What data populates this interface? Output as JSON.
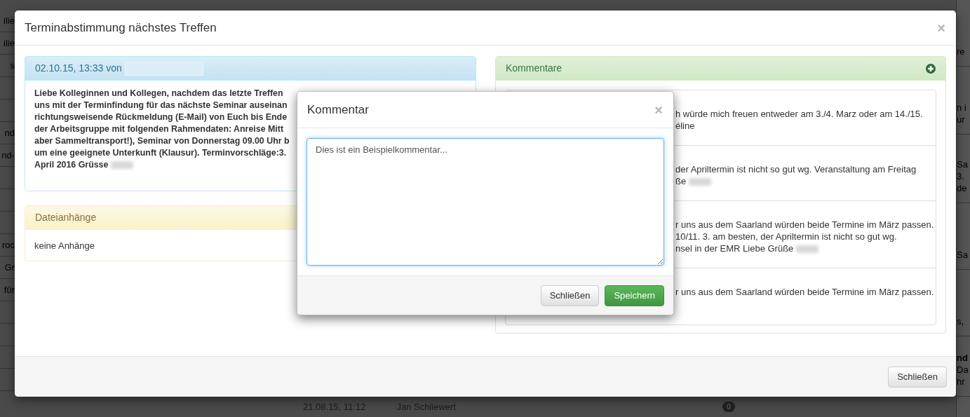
{
  "dialog": {
    "title": "Terminabstimmung nächstes Treffen",
    "close": "×",
    "message": {
      "meta": "02.10.15, 13:33 von",
      "meta_redacted": true,
      "body_lines": [
        {
          "text": "Liebe Kolleginnen und Kollegen, nachdem das letzte Treffen",
          "redacted_after": false
        },
        {
          "text": "uns mit der Terminfindung für das nächste Seminar auseinan",
          "redacted_after": false
        },
        {
          "text": "richtungsweisende Rückmeldung (E-Mail) von Euch bis Ende",
          "redacted_after": false
        },
        {
          "text": "der Arbeitsgruppe mit folgenden Rahmendaten: Anreise Mitt",
          "redacted_after": false
        },
        {
          "text": "aber Sammeltransport!), Seminar von Donnerstag 09.00 Uhr b",
          "redacted_after": false
        },
        {
          "text": "um eine geeignete Unterkunft (Klausur). Terminvorschläge:3.",
          "redacted_after": false
        },
        {
          "text": "April 2016 Grüsse",
          "redacted_after": true
        }
      ]
    },
    "attachments": {
      "title": "Dateianhänge",
      "text": "keine Anhänge"
    },
    "comments": {
      "title": "Kommentare",
      "items": [
        {
          "lines": [
            {
              "text": "h würde mich freuen entweder am 3./4. Marz oder am 14./15.",
              "redacted_after": false
            },
            {
              "text": "éline",
              "redacted_after": false
            }
          ]
        },
        {
          "lines": [
            {
              "text": "der Apriltermin ist nicht so gut wg. Veranstaltung am Freitag",
              "redacted_after": false
            },
            {
              "text": "ße",
              "redacted_after": true
            }
          ]
        },
        {
          "lines": [
            {
              "text": "r uns aus dem Saarland würden beide Termine im März passen.",
              "redacted_after": false
            },
            {
              "text": "10/11. 3. am besten, der Apriltermin ist nicht so gut wg.",
              "redacted_after": false
            },
            {
              "text": "nsel in der EMR Liebe Grüße",
              "redacted_after": true
            }
          ]
        },
        {
          "lines": [
            {
              "text": "r uns aus dem Saarland würden beide Termine im März passen.",
              "redacted_after": false
            }
          ]
        }
      ]
    },
    "footer_button": "Schließen"
  },
  "comment_dialog": {
    "title": "Kommentar",
    "close": "×",
    "value": "Dies ist ein Beispielkommentar...",
    "buttons": [
      {
        "label": "Schließen",
        "kind": "default"
      },
      {
        "label": "Speichern",
        "kind": "success"
      }
    ]
  },
  "backdrop": {
    "left_rows": [
      {
        "text": "ilie"
      },
      {
        "text": "ilie"
      },
      {
        "text": "s"
      },
      {},
      {},
      {
        "text": "nd"
      },
      {
        "text": "nd-"
      },
      {},
      {},
      {},
      {
        "text": "roc"
      },
      {
        "text": "Gr"
      },
      {
        "text": "für"
      },
      {},
      {},
      {},
      {}
    ],
    "right_blocks": [
      {
        "lines": [
          "re"
        ]
      },
      {
        "lines": [
          "n i",
          "ur"
        ]
      },
      {
        "lines": [
          "Sa",
          "3.",
          "de"
        ]
      },
      {
        "lines": [
          "Sa"
        ]
      },
      {
        "lines": [
          "s,"
        ]
      },
      {
        "lines": [
          "nd",
          "Da",
          "hr"
        ]
      }
    ],
    "bottom_row": {
      "date": "21.08.15, 11:12",
      "author": "Jan Schliewert",
      "count": "0"
    }
  }
}
